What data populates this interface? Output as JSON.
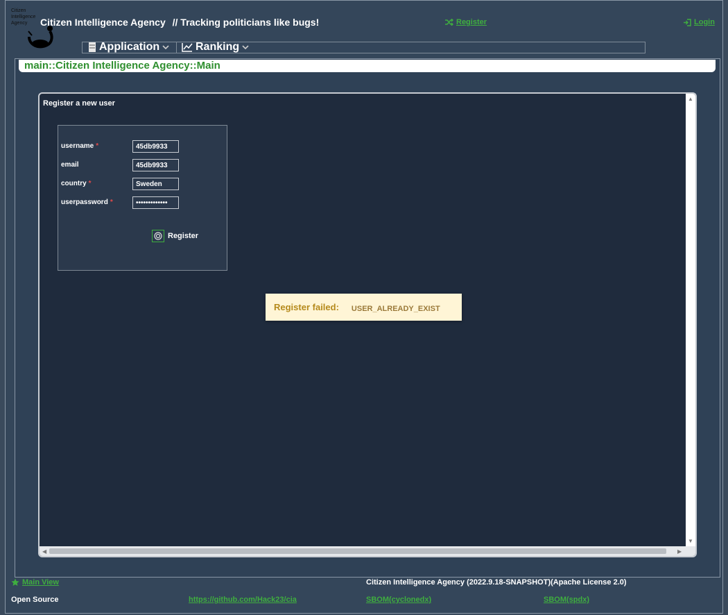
{
  "header": {
    "logo_text": [
      "Citizen",
      "Intelligence",
      "Agency"
    ],
    "app_title": "Citizen Intelligence Agency",
    "tagline": "// Tracking politicians like bugs!",
    "register_link": "Register",
    "login_link": "Login"
  },
  "menu": {
    "items": [
      {
        "label": "Application",
        "icon": "server-icon"
      },
      {
        "label": "Ranking",
        "icon": "chart-line-icon"
      }
    ]
  },
  "breadcrumb": "main::Citizen Intelligence Agency::Main",
  "register_window": {
    "title": "Register a new user",
    "fields": [
      {
        "label": "username",
        "required": true,
        "value": "45db9933"
      },
      {
        "label": "email",
        "required": false,
        "value": "45db9933"
      },
      {
        "label": "country",
        "required": true,
        "value": "Sweden"
      },
      {
        "label": "userpassword",
        "required": true,
        "value": "•••••••••••••"
      }
    ],
    "register_button": "Register"
  },
  "notification": {
    "title": "Register failed:",
    "message": "USER_ALREADY_EXIST"
  },
  "footer": {
    "main_view": "Main View",
    "version": "Citizen Intelligence Agency (2022.9.18-SNAPSHOT)(Apache License 2.0)",
    "open_source_label": "Open Source",
    "github_link": "https://github.com/Hack23/cia",
    "sbom_cyclonedx": "SBOM(cyclonedx)",
    "sbom_spdx": "SBOM(spdx)"
  },
  "colors": {
    "accent_green": "#3fae3f",
    "warning_bg": "#fff5d6",
    "required": "#e04a4a"
  }
}
